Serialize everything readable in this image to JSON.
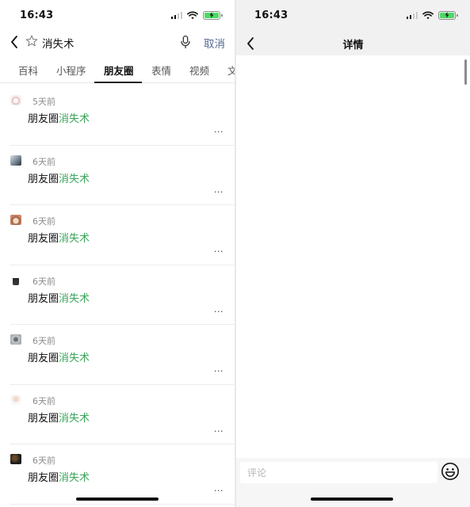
{
  "left": {
    "status": {
      "time": "16:43"
    },
    "search": {
      "query": "消失术",
      "cancel_label": "取消"
    },
    "tabs": [
      {
        "label": "百科"
      },
      {
        "label": "小程序"
      },
      {
        "label": "朋友圈",
        "active": true
      },
      {
        "label": "表情"
      },
      {
        "label": "视频"
      },
      {
        "label": "文"
      }
    ],
    "results": [
      {
        "time": "5天前",
        "text_prefix": "朋友圈",
        "text_highlight": "消失术",
        "more": "···"
      },
      {
        "time": "6天前",
        "text_prefix": "朋友圈",
        "text_highlight": "消失术",
        "more": "···"
      },
      {
        "time": "6天前",
        "text_prefix": "朋友圈",
        "text_highlight": "消失术",
        "more": "···"
      },
      {
        "time": "6天前",
        "text_prefix": "朋友圈",
        "text_highlight": "消失术",
        "more": "···"
      },
      {
        "time": "6天前",
        "text_prefix": "朋友圈",
        "text_highlight": "消失术",
        "more": "···"
      },
      {
        "time": "6天前",
        "text_prefix": "朋友圈",
        "text_highlight": "消失术",
        "more": "···"
      },
      {
        "time": "6天前",
        "text_prefix": "朋友圈",
        "text_highlight": "消失术",
        "more": "···"
      }
    ]
  },
  "right": {
    "status": {
      "time": "16:43"
    },
    "nav": {
      "title": "详情"
    },
    "comment": {
      "placeholder": "评论",
      "value": ""
    }
  },
  "icons": {
    "back": "chevron-left-icon",
    "star": "star-outline-icon",
    "mic": "microphone-icon",
    "emoji": "smiley-icon",
    "signal": "cellular-signal-icon",
    "wifi": "wifi-icon",
    "battery": "battery-charging-icon"
  },
  "colors": {
    "highlight": "#3aa55a",
    "link": "#576b95",
    "battery": "#4cd964",
    "muted": "#8c8c8c"
  }
}
